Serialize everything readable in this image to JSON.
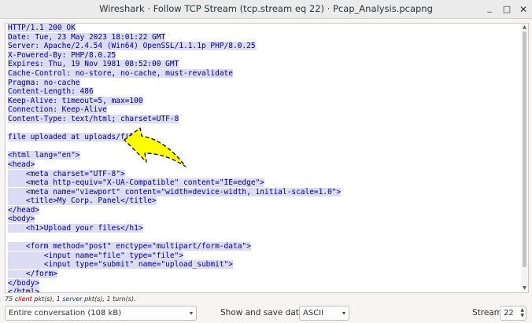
{
  "window": {
    "title": "Wireshark · Follow TCP Stream (tcp.stream eq 22) · Pcap_Analysis.pcapng",
    "minimize_glyph": "_",
    "maximize_glyph": "□",
    "close_glyph": "✕"
  },
  "stream_lines": [
    "HTTP/1.1 200 OK",
    "Date: Tue, 23 May 2023 18:01:22 GMT",
    "Server: Apache/2.4.54 (Win64) OpenSSL/1.1.1p PHP/8.0.25",
    "X-Powered-By: PHP/8.0.25",
    "Expires: Thu, 19 Nov 1981 08:52:00 GMT",
    "Cache-Control: no-store, no-cache, must-revalidate",
    "Pragma: no-cache",
    "Content-Length: 486",
    "Keep-Alive: timeout=5, max=100",
    "Connection: Keep-Alive",
    "Content-Type: text/html; charset=UTF-8",
    "",
    "file uploaded at uploads/file",
    "",
    "<html lang=\"en\">",
    "<head>",
    "    <meta charset=\"UTF-8\">",
    "    <meta http-equiv=\"X-UA-Compatible\" content=\"IE=edge\">",
    "    <meta name=\"viewport\" content=\"width=device-width, initial-scale=1.0\">",
    "    <title>My Corp. Panel</title>",
    "</head>",
    "<body>",
    "    <h1>Upload your files</h1>",
    "",
    "    <form method=\"post\" enctype=\"multipart/form-data\">",
    "        <input name=\"file\" type=\"file\">",
    "        <input type=\"submit\" name=\"upload_submit\">",
    "    </form>",
    "</body>",
    "</html>"
  ],
  "summary": {
    "client_count": "75",
    "client_word": "client",
    "client_rest": " pkt(s), ",
    "server_count": "1",
    "server_word": "server",
    "server_rest": " pkt(s), 1 turn(s)."
  },
  "controls": {
    "conversation_select": "Entire conversation (108 kB)",
    "save_label": "Show and save data as",
    "format_select": "ASCII",
    "stream_label": "Stream",
    "stream_value": "22"
  },
  "colors": {
    "server_text": "#000080",
    "server_bg": "#dcdcf4",
    "annotation_arrow": "#ffff00"
  },
  "icons": {
    "select_caret": "▾",
    "spin_up": "▲",
    "spin_down": "▼",
    "scroll_up": "▲",
    "scroll_down": "▼"
  }
}
